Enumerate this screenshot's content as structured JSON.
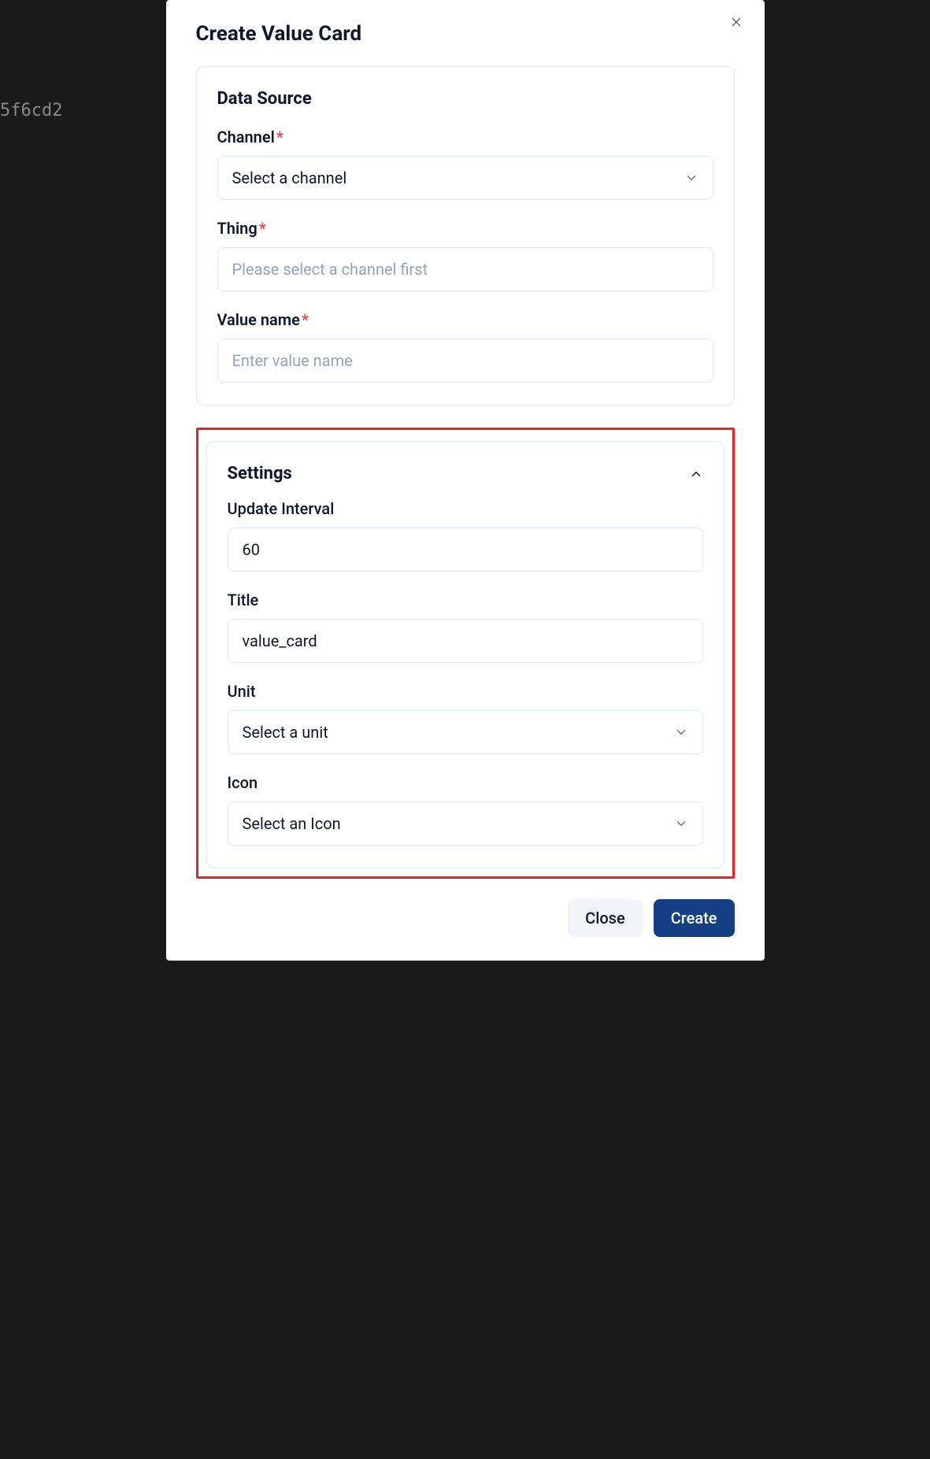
{
  "background": {
    "fragment": "5f6cd2"
  },
  "modal": {
    "title": "Create Value Card",
    "dataSource": {
      "heading": "Data Source",
      "channel": {
        "label": "Channel",
        "placeholder": "Select a channel"
      },
      "thing": {
        "label": "Thing",
        "placeholder": "Please select a channel first"
      },
      "valueName": {
        "label": "Value name",
        "placeholder": "Enter value name"
      }
    },
    "settings": {
      "heading": "Settings",
      "updateInterval": {
        "label": "Update Interval",
        "value": "60"
      },
      "title": {
        "label": "Title",
        "value": "value_card"
      },
      "unit": {
        "label": "Unit",
        "placeholder": "Select a unit"
      },
      "icon": {
        "label": "Icon",
        "placeholder": "Select an Icon"
      }
    },
    "footer": {
      "close": "Close",
      "create": "Create"
    }
  }
}
